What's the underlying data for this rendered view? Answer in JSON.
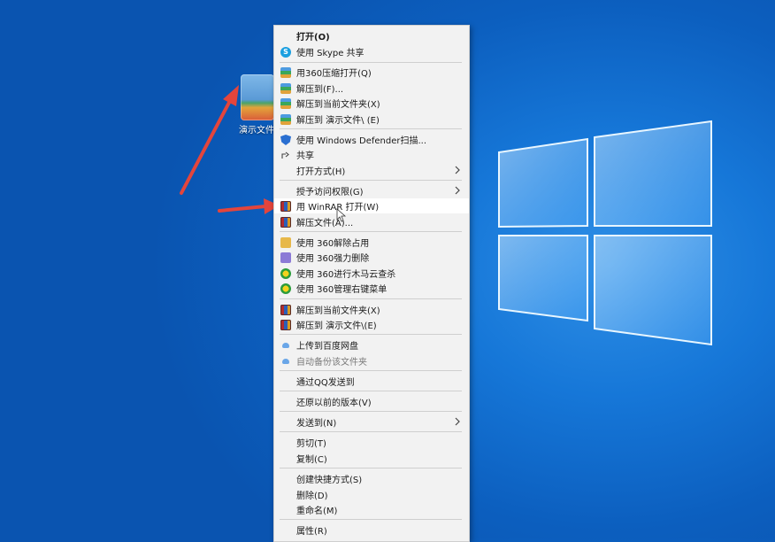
{
  "desktop": {
    "file_label": "演示文件",
    "colors": {
      "accent_arrow": "#e3453c",
      "menu_bg": "#f2f2f2",
      "highlight": "#ffffff"
    }
  },
  "menu": {
    "items": [
      {
        "label": "打开(O)",
        "icon": "none",
        "bold": true
      },
      {
        "label": "使用 Skype 共享",
        "icon": "skype-icon"
      },
      {
        "label": "用360压缩打开(Q)",
        "icon": "zip-icon"
      },
      {
        "label": "解压到(F)...",
        "icon": "zip-icon"
      },
      {
        "label": "解压到当前文件夹(X)",
        "icon": "zip-icon"
      },
      {
        "label": "解压到 演示文件\\ (E)",
        "icon": "zip-icon"
      },
      {
        "label": "使用 Windows Defender扫描...",
        "icon": "defender-shield-icon"
      },
      {
        "label": "共享",
        "icon": "share-icon"
      },
      {
        "label": "打开方式(H)",
        "icon": "none",
        "submenu": true
      },
      {
        "label": "授予访问权限(G)",
        "icon": "none",
        "submenu": true
      },
      {
        "label": "用 WinRAR 打开(W)",
        "icon": "winrar-icon",
        "highlighted": true
      },
      {
        "label": "解压文件(A)...",
        "icon": "winrar-icon"
      },
      {
        "label": "使用 360解除占用",
        "icon": "unlock-icon"
      },
      {
        "label": "使用 360强力删除",
        "icon": "delete-icon"
      },
      {
        "label": "使用 360进行木马云查杀",
        "icon": "360-icon"
      },
      {
        "label": "使用 360管理右键菜单",
        "icon": "360-icon"
      },
      {
        "label": "解压到当前文件夹(X)",
        "icon": "winrar-icon"
      },
      {
        "label": "解压到 演示文件\\(E)",
        "icon": "winrar-icon"
      },
      {
        "label": "上传到百度网盘",
        "icon": "cloud-icon"
      },
      {
        "label": "自动备份该文件夹",
        "icon": "cloud-icon",
        "disabled": true
      },
      {
        "label": "通过QQ发送到",
        "icon": "none"
      },
      {
        "label": "还原以前的版本(V)",
        "icon": "none"
      },
      {
        "label": "发送到(N)",
        "icon": "none",
        "submenu": true
      },
      {
        "label": "剪切(T)",
        "icon": "none"
      },
      {
        "label": "复制(C)",
        "icon": "none"
      },
      {
        "label": "创建快捷方式(S)",
        "icon": "none"
      },
      {
        "label": "删除(D)",
        "icon": "none"
      },
      {
        "label": "重命名(M)",
        "icon": "none"
      },
      {
        "label": "属性(R)",
        "icon": "none"
      }
    ]
  }
}
